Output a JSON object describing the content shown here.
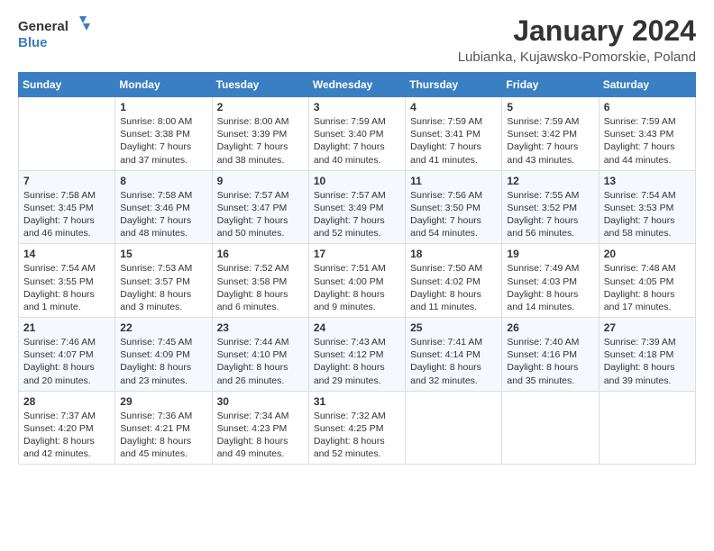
{
  "header": {
    "logo_general": "General",
    "logo_blue": "Blue",
    "month_title": "January 2024",
    "location": "Lubianka, Kujawsko-Pomorskie, Poland"
  },
  "weekdays": [
    "Sunday",
    "Monday",
    "Tuesday",
    "Wednesday",
    "Thursday",
    "Friday",
    "Saturday"
  ],
  "weeks": [
    [
      {
        "day": "",
        "sunrise": "",
        "sunset": "",
        "daylight": ""
      },
      {
        "day": "1",
        "sunrise": "Sunrise: 8:00 AM",
        "sunset": "Sunset: 3:38 PM",
        "daylight": "Daylight: 7 hours and 37 minutes."
      },
      {
        "day": "2",
        "sunrise": "Sunrise: 8:00 AM",
        "sunset": "Sunset: 3:39 PM",
        "daylight": "Daylight: 7 hours and 38 minutes."
      },
      {
        "day": "3",
        "sunrise": "Sunrise: 7:59 AM",
        "sunset": "Sunset: 3:40 PM",
        "daylight": "Daylight: 7 hours and 40 minutes."
      },
      {
        "day": "4",
        "sunrise": "Sunrise: 7:59 AM",
        "sunset": "Sunset: 3:41 PM",
        "daylight": "Daylight: 7 hours and 41 minutes."
      },
      {
        "day": "5",
        "sunrise": "Sunrise: 7:59 AM",
        "sunset": "Sunset: 3:42 PM",
        "daylight": "Daylight: 7 hours and 43 minutes."
      },
      {
        "day": "6",
        "sunrise": "Sunrise: 7:59 AM",
        "sunset": "Sunset: 3:43 PM",
        "daylight": "Daylight: 7 hours and 44 minutes."
      }
    ],
    [
      {
        "day": "7",
        "sunrise": "Sunrise: 7:58 AM",
        "sunset": "Sunset: 3:45 PM",
        "daylight": "Daylight: 7 hours and 46 minutes."
      },
      {
        "day": "8",
        "sunrise": "Sunrise: 7:58 AM",
        "sunset": "Sunset: 3:46 PM",
        "daylight": "Daylight: 7 hours and 48 minutes."
      },
      {
        "day": "9",
        "sunrise": "Sunrise: 7:57 AM",
        "sunset": "Sunset: 3:47 PM",
        "daylight": "Daylight: 7 hours and 50 minutes."
      },
      {
        "day": "10",
        "sunrise": "Sunrise: 7:57 AM",
        "sunset": "Sunset: 3:49 PM",
        "daylight": "Daylight: 7 hours and 52 minutes."
      },
      {
        "day": "11",
        "sunrise": "Sunrise: 7:56 AM",
        "sunset": "Sunset: 3:50 PM",
        "daylight": "Daylight: 7 hours and 54 minutes."
      },
      {
        "day": "12",
        "sunrise": "Sunrise: 7:55 AM",
        "sunset": "Sunset: 3:52 PM",
        "daylight": "Daylight: 7 hours and 56 minutes."
      },
      {
        "day": "13",
        "sunrise": "Sunrise: 7:54 AM",
        "sunset": "Sunset: 3:53 PM",
        "daylight": "Daylight: 7 hours and 58 minutes."
      }
    ],
    [
      {
        "day": "14",
        "sunrise": "Sunrise: 7:54 AM",
        "sunset": "Sunset: 3:55 PM",
        "daylight": "Daylight: 8 hours and 1 minute."
      },
      {
        "day": "15",
        "sunrise": "Sunrise: 7:53 AM",
        "sunset": "Sunset: 3:57 PM",
        "daylight": "Daylight: 8 hours and 3 minutes."
      },
      {
        "day": "16",
        "sunrise": "Sunrise: 7:52 AM",
        "sunset": "Sunset: 3:58 PM",
        "daylight": "Daylight: 8 hours and 6 minutes."
      },
      {
        "day": "17",
        "sunrise": "Sunrise: 7:51 AM",
        "sunset": "Sunset: 4:00 PM",
        "daylight": "Daylight: 8 hours and 9 minutes."
      },
      {
        "day": "18",
        "sunrise": "Sunrise: 7:50 AM",
        "sunset": "Sunset: 4:02 PM",
        "daylight": "Daylight: 8 hours and 11 minutes."
      },
      {
        "day": "19",
        "sunrise": "Sunrise: 7:49 AM",
        "sunset": "Sunset: 4:03 PM",
        "daylight": "Daylight: 8 hours and 14 minutes."
      },
      {
        "day": "20",
        "sunrise": "Sunrise: 7:48 AM",
        "sunset": "Sunset: 4:05 PM",
        "daylight": "Daylight: 8 hours and 17 minutes."
      }
    ],
    [
      {
        "day": "21",
        "sunrise": "Sunrise: 7:46 AM",
        "sunset": "Sunset: 4:07 PM",
        "daylight": "Daylight: 8 hours and 20 minutes."
      },
      {
        "day": "22",
        "sunrise": "Sunrise: 7:45 AM",
        "sunset": "Sunset: 4:09 PM",
        "daylight": "Daylight: 8 hours and 23 minutes."
      },
      {
        "day": "23",
        "sunrise": "Sunrise: 7:44 AM",
        "sunset": "Sunset: 4:10 PM",
        "daylight": "Daylight: 8 hours and 26 minutes."
      },
      {
        "day": "24",
        "sunrise": "Sunrise: 7:43 AM",
        "sunset": "Sunset: 4:12 PM",
        "daylight": "Daylight: 8 hours and 29 minutes."
      },
      {
        "day": "25",
        "sunrise": "Sunrise: 7:41 AM",
        "sunset": "Sunset: 4:14 PM",
        "daylight": "Daylight: 8 hours and 32 minutes."
      },
      {
        "day": "26",
        "sunrise": "Sunrise: 7:40 AM",
        "sunset": "Sunset: 4:16 PM",
        "daylight": "Daylight: 8 hours and 35 minutes."
      },
      {
        "day": "27",
        "sunrise": "Sunrise: 7:39 AM",
        "sunset": "Sunset: 4:18 PM",
        "daylight": "Daylight: 8 hours and 39 minutes."
      }
    ],
    [
      {
        "day": "28",
        "sunrise": "Sunrise: 7:37 AM",
        "sunset": "Sunset: 4:20 PM",
        "daylight": "Daylight: 8 hours and 42 minutes."
      },
      {
        "day": "29",
        "sunrise": "Sunrise: 7:36 AM",
        "sunset": "Sunset: 4:21 PM",
        "daylight": "Daylight: 8 hours and 45 minutes."
      },
      {
        "day": "30",
        "sunrise": "Sunrise: 7:34 AM",
        "sunset": "Sunset: 4:23 PM",
        "daylight": "Daylight: 8 hours and 49 minutes."
      },
      {
        "day": "31",
        "sunrise": "Sunrise: 7:32 AM",
        "sunset": "Sunset: 4:25 PM",
        "daylight": "Daylight: 8 hours and 52 minutes."
      },
      {
        "day": "",
        "sunrise": "",
        "sunset": "",
        "daylight": ""
      },
      {
        "day": "",
        "sunrise": "",
        "sunset": "",
        "daylight": ""
      },
      {
        "day": "",
        "sunrise": "",
        "sunset": "",
        "daylight": ""
      }
    ]
  ]
}
